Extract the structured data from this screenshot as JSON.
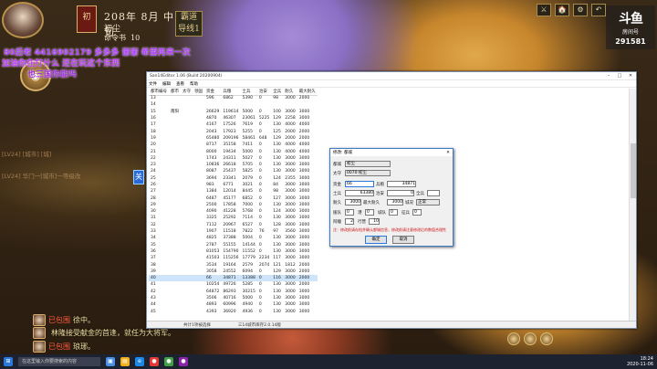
{
  "hud": {
    "seal": "初",
    "date": "208年 8月 中旬",
    "rank": "初尘",
    "command": "命令书",
    "command_count": "10",
    "badge_line1": "霸道",
    "badge_line2": "导线1"
  },
  "danmu": [
    "80后老  4416902179  多多多  谢谢  希望再来一次",
    "加油你在打什么  还在玩这个东西",
    "也三国你能吗"
  ],
  "side_chat": [
    "[LV24]  [城市]  [城]",
    "[LV24] 华门一[城市]一等级改"
  ],
  "topright": {
    "buttons": [
      "⚔",
      "🏠",
      "⚙",
      "↶"
    ]
  },
  "logo": {
    "l1": "斗鱼",
    "l2": "房间号",
    "l3": "291581"
  },
  "window": {
    "title": "San14Editor 1.06 (Build 20200904)",
    "menus": [
      "文件",
      "编辑",
      "查看",
      "帮助"
    ],
    "columns": [
      "都市编号",
      "都市",
      "太守",
      "领国",
      "资金",
      "兵粮",
      "士兵",
      "治安",
      "全兵",
      "耐久",
      "最大耐久"
    ],
    "rows": [
      [
        "13",
        "",
        "",
        "",
        "596",
        "6862",
        "5390",
        "0",
        "98",
        "3000",
        "2000"
      ],
      [
        "14",
        "",
        "",
        "",
        "",
        "",
        "",
        "",
        "",
        "",
        ""
      ],
      [
        "15",
        "南阳",
        "",
        "",
        "26629",
        "119614",
        "5000",
        "0",
        "100",
        "3000",
        "3000"
      ],
      [
        "16",
        "",
        "",
        "",
        "4870",
        "46307",
        "23061",
        "5225",
        "129",
        "2258",
        "3000"
      ],
      [
        "17",
        "",
        "",
        "",
        "4167",
        "17526",
        "7619",
        "0",
        "130",
        "4000",
        "4000"
      ],
      [
        "18",
        "",
        "",
        "",
        "2043",
        "17923",
        "5255",
        "0",
        "125",
        "2000",
        "2000"
      ],
      [
        "19",
        "",
        "",
        "",
        "65480",
        "209196",
        "58461",
        "648",
        "129",
        "2000",
        "2000"
      ],
      [
        "20",
        "",
        "",
        "",
        "8717",
        "35158",
        "7411",
        "0",
        "130",
        "4000",
        "4000"
      ],
      [
        "21",
        "",
        "",
        "",
        "8000",
        "19434",
        "5000",
        "0",
        "130",
        "4000",
        "4000"
      ],
      [
        "22",
        "",
        "",
        "",
        "1743",
        "24311",
        "5027",
        "0",
        "130",
        "3000",
        "3000"
      ],
      [
        "23",
        "",
        "",
        "",
        "10836",
        "26618",
        "5705",
        "0",
        "130",
        "3000",
        "3000"
      ],
      [
        "24",
        "",
        "",
        "",
        "8087",
        "25437",
        "5825",
        "0",
        "130",
        "3000",
        "3000"
      ],
      [
        "25",
        "",
        "",
        "",
        "3694",
        "23341",
        "2079",
        "0",
        "124",
        "2355",
        "3000"
      ],
      [
        "26",
        "",
        "",
        "",
        "983",
        "6771",
        "3021",
        "0",
        "84",
        "3000",
        "3000"
      ],
      [
        "27",
        "",
        "",
        "",
        "1384",
        "12014",
        "8445",
        "0",
        "98",
        "3000",
        "3000"
      ],
      [
        "28",
        "",
        "",
        "",
        "6487",
        "45177",
        "6852",
        "0",
        "127",
        "3000",
        "3000"
      ],
      [
        "29",
        "",
        "",
        "",
        "2500",
        "17858",
        "7000",
        "0",
        "130",
        "3000",
        "3000"
      ],
      [
        "30",
        "",
        "",
        "",
        "4090",
        "41228",
        "5768",
        "0",
        "124",
        "3000",
        "3000"
      ],
      [
        "31",
        "",
        "",
        "",
        "3325",
        "25292",
        "7114",
        "0",
        "130",
        "3000",
        "3000"
      ],
      [
        "32",
        "",
        "",
        "",
        "7112",
        "20967",
        "6527",
        "0",
        "128",
        "3000",
        "3000"
      ],
      [
        "33",
        "",
        "",
        "",
        "1907",
        "11518",
        "7822",
        "76",
        "97",
        "3560",
        "3000"
      ],
      [
        "34",
        "",
        "",
        "",
        "4825",
        "37388",
        "5004",
        "0",
        "130",
        "3000",
        "3000"
      ],
      [
        "35",
        "",
        "",
        "",
        "2787",
        "55155",
        "14144",
        "0",
        "130",
        "3000",
        "3000"
      ],
      [
        "36",
        "",
        "",
        "",
        "81053",
        "154790",
        "11552",
        "0",
        "130",
        "3000",
        "3000"
      ],
      [
        "37",
        "",
        "",
        "",
        "41503",
        "115256",
        "17779",
        "2234",
        "117",
        "3000",
        "3000"
      ],
      [
        "38",
        "",
        "",
        "",
        "3534",
        "19164",
        "2579",
        "2074",
        "121",
        "1812",
        "2000"
      ],
      [
        "39",
        "",
        "",
        "",
        "3058",
        "24552",
        "6094",
        "0",
        "129",
        "3000",
        "2000"
      ],
      [
        "40",
        "",
        "",
        "",
        "66",
        "34871",
        "13388",
        "0",
        "116",
        "3000",
        "2000"
      ],
      [
        "41",
        "",
        "",
        "",
        "10254",
        "49726",
        "5285",
        "0",
        "130",
        "3000",
        "2000"
      ],
      [
        "42",
        "",
        "",
        "",
        "64872",
        "86293",
        "30215",
        "0",
        "130",
        "3000",
        "3000"
      ],
      [
        "43",
        "",
        "",
        "",
        "3506",
        "40716",
        "5000",
        "0",
        "130",
        "3000",
        "3000"
      ],
      [
        "44",
        "",
        "",
        "",
        "4893",
        "60996",
        "4940",
        "0",
        "130",
        "3000",
        "3000"
      ],
      [
        "45",
        "",
        "",
        "",
        "4393",
        "36920",
        "4936",
        "0",
        "130",
        "3000",
        "3000"
      ]
    ],
    "selected_row": 27,
    "status": [
      "共计1项被选择",
      "三14城市库存2.0.14版"
    ]
  },
  "dialog": {
    "title": "修改: 都城",
    "field_city_label": "都城",
    "field_city_value": "初尘",
    "field_gov_label": "太守",
    "field_gov_value": "0070:初尘",
    "money_label": "资金",
    "money_value": "66",
    "food_label": "兵粮",
    "food_value": "34871",
    "soldier_label": "士兵",
    "soldier_value": "63380",
    "security_label": "治安",
    "security_value": "0",
    "full_label": "全兵",
    "dur_label": "耐久",
    "dur_value": "3000",
    "maxdur_label": "最大耐久",
    "maxdur_value": "3000",
    "status_label": "城况",
    "status_value": "正常",
    "a_label": "援队",
    "a_value": "0",
    "b_label": "港",
    "b_value": "0",
    "c_label": "城队",
    "c_value": "0",
    "d_label": "征兵",
    "d_value": "0",
    "e_label": "阿瞳",
    "e_value": "2",
    "f_label": "行营",
    "f_value": "10",
    "note": "注：修改前请存档并确认都城信息，修改前请注意修改后的数值合理性",
    "ok": "确定",
    "cancel": "取消"
  },
  "chat": [
    {
      "name": "已包围",
      "text": "徐中。"
    },
    {
      "name": "",
      "text": "林隆接受献金的首逢，就任为大将军。"
    },
    {
      "name": "已包围",
      "text": "琅琊。"
    }
  ],
  "taskbar": {
    "search": "在这里输入你要搜索的内容",
    "time": "18:24",
    "date": "2020-11-06"
  }
}
